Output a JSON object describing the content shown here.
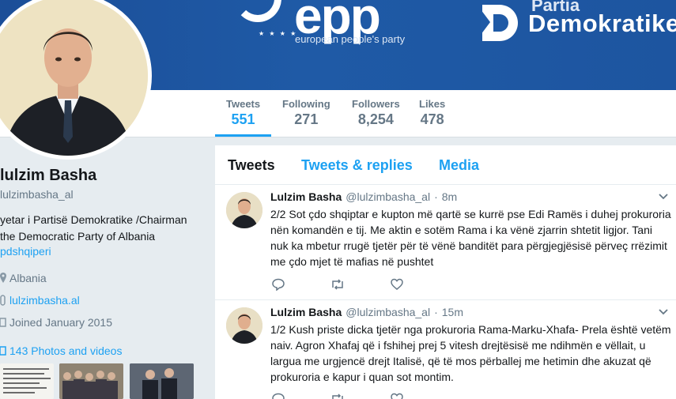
{
  "banner": {
    "epp_logo": "epp",
    "epp_tagline": "european people's party",
    "pd_partia": "Partia",
    "pd_name": "Demokratike"
  },
  "stats": [
    {
      "label": "Tweets",
      "value": "551",
      "active": true
    },
    {
      "label": "Following",
      "value": "271",
      "active": false
    },
    {
      "label": "Followers",
      "value": "8,254",
      "active": false
    },
    {
      "label": "Likes",
      "value": "478",
      "active": false
    }
  ],
  "profile": {
    "name": "lulzim Basha",
    "handle": "lulzimbasha_al",
    "bio_line1": "yetar i Partisë Demokratike /Chairman",
    "bio_line2": "the Democratic Party of Albania",
    "bio_mention": "pdshqiperi",
    "location": "Albania",
    "website": "lulzimbasha.al",
    "joined": "Joined January 2015",
    "photos_label": "143 Photos and videos"
  },
  "tabs": [
    "Tweets",
    "Tweets & replies",
    "Media"
  ],
  "tweets": [
    {
      "name": "Lulzim Basha",
      "handle": "@lulzimbasha_al",
      "dot": "·",
      "time": "8m",
      "text": "2/2 Sot çdo shqiptar e kupton më qartë se kurrë pse Edi Ramës i duhej prokuroria nën komandën e tij. Me aktin e sotëm Rama i ka vënë zjarrin shtetit ligjor. Tani nuk ka mbetur rrugë tjetër për të vënë banditët para përgjegjësisë përveç rrëzimit me çdo mjet të mafias në pushtet"
    },
    {
      "name": "Lulzim Basha",
      "handle": "@lulzimbasha_al",
      "dot": "·",
      "time": "15m",
      "text": "1/2 Kush priste dicka tjetër nga prokuroria Rama-Marku-Xhafa- Prela është vetëm naiv. Agron Xhafaj që i fshihej prej 5 vitesh drejtësisë me ndihmën e vëllait, u largua me urgjencë drejt Italisë, që të mos përballej me hetimin dhe akuzat që prokuroria e kapur i quan sot montim."
    }
  ],
  "colors": {
    "accent": "#1da1f2",
    "banner": "#1f5aa6",
    "muted": "#657786"
  }
}
